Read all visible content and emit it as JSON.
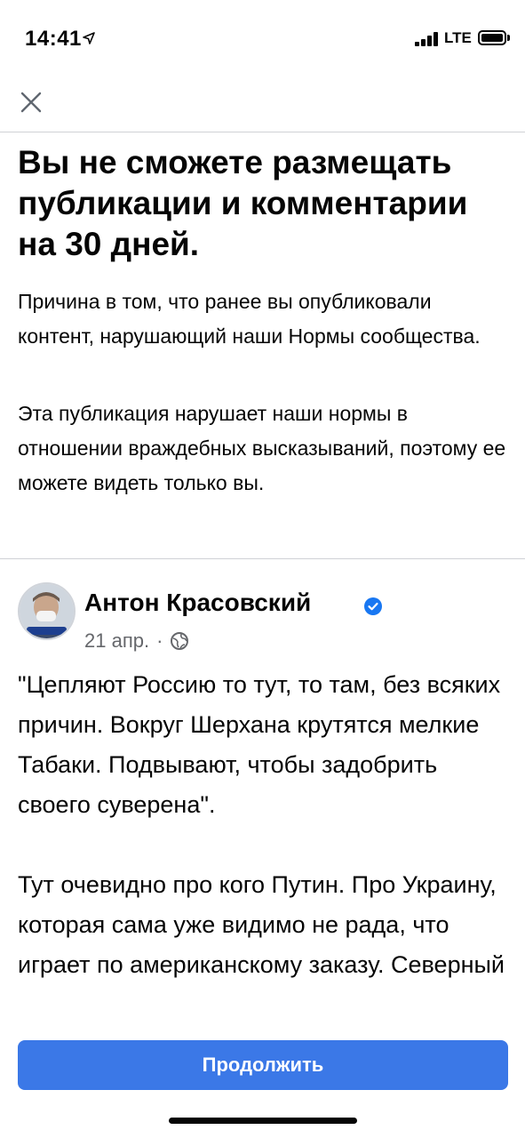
{
  "status_bar": {
    "time": "14:41",
    "network": "LTE",
    "icons": [
      "location-arrow-icon",
      "signal-icon",
      "battery-icon"
    ]
  },
  "header": {
    "close_icon": "close-icon"
  },
  "notice": {
    "headline": "Вы не сможете размещать публикации и комментарии на 30 дней.",
    "reason": "Причина в том, что ранее вы опубликовали контент, нарушающий наши Нормы сообщества.",
    "policy": "Эта публикация нарушает наши нормы в отношении враждебных высказываний, поэтому ее можете видеть только вы."
  },
  "post": {
    "author": "Антон Красовский",
    "verified_icon": "verified-badge-icon",
    "date": "21 апр.",
    "separator": "·",
    "audience_icon": "globe-icon",
    "paragraphs": [
      "\"Цепляют Россию то тут, то там, без всяких причин. Вокруг Шерхана крутятся мелкие Табаки. Подвывают, чтобы задобрить своего суверена\".",
      "Тут очевидно про кого Путин. Про Украину, которая сама уже видимо не рада, что играет по американскому заказу. Северный"
    ]
  },
  "footer": {
    "continue_label": "Продолжить"
  },
  "colors": {
    "accent": "#3b78e7",
    "meta_text": "#65676b",
    "divider": "#cfd1d5"
  }
}
